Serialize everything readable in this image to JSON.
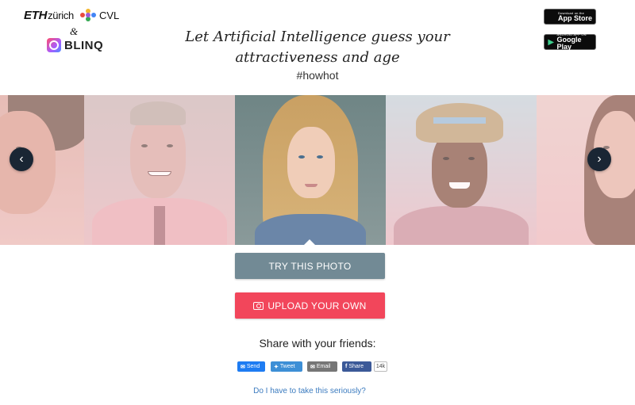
{
  "header": {
    "eth_logo": "ETH",
    "eth_logo_suffix": "zürich",
    "cvl_logo": "CVL",
    "ampersand": "&",
    "blinq_logo": "BLINQ",
    "headline": "Let Artificial Intelligence guess your attractiveness and age",
    "hashtag": "#howhot"
  },
  "store_badges": {
    "apple": {
      "small": "Download on the",
      "big": "App Store",
      "icon": "apple-icon"
    },
    "google": {
      "small": "ANDROID APP ON",
      "big": "Google Play",
      "icon": "play-icon"
    }
  },
  "carousel": {
    "prev_icon": "‹",
    "next_icon": "›",
    "photos": [
      "man-curly-hair",
      "man-grimacing-tie",
      "woman-blonde-selected",
      "man-straw-hat-smiling",
      "woman-dark-hair"
    ]
  },
  "actions": {
    "try_label": "TRY THIS PHOTO",
    "upload_label": "UPLOAD YOUR OWN"
  },
  "share": {
    "title": "Share with your friends:",
    "send_label": "Send",
    "tweet_label": "Tweet",
    "email_label": "Email",
    "facebook_label": "Share",
    "facebook_count": "14k"
  },
  "footer_link": "Do I have to take this seriously?",
  "colors": {
    "try_button": "#728a95",
    "upload_button": "#f2465b",
    "arrow_bg": "#1a2634",
    "link": "#3b7bbf",
    "messenger": "#1e7cf2",
    "twitter": "#3d8fd6",
    "email": "#767676",
    "facebook": "#3b5998"
  }
}
